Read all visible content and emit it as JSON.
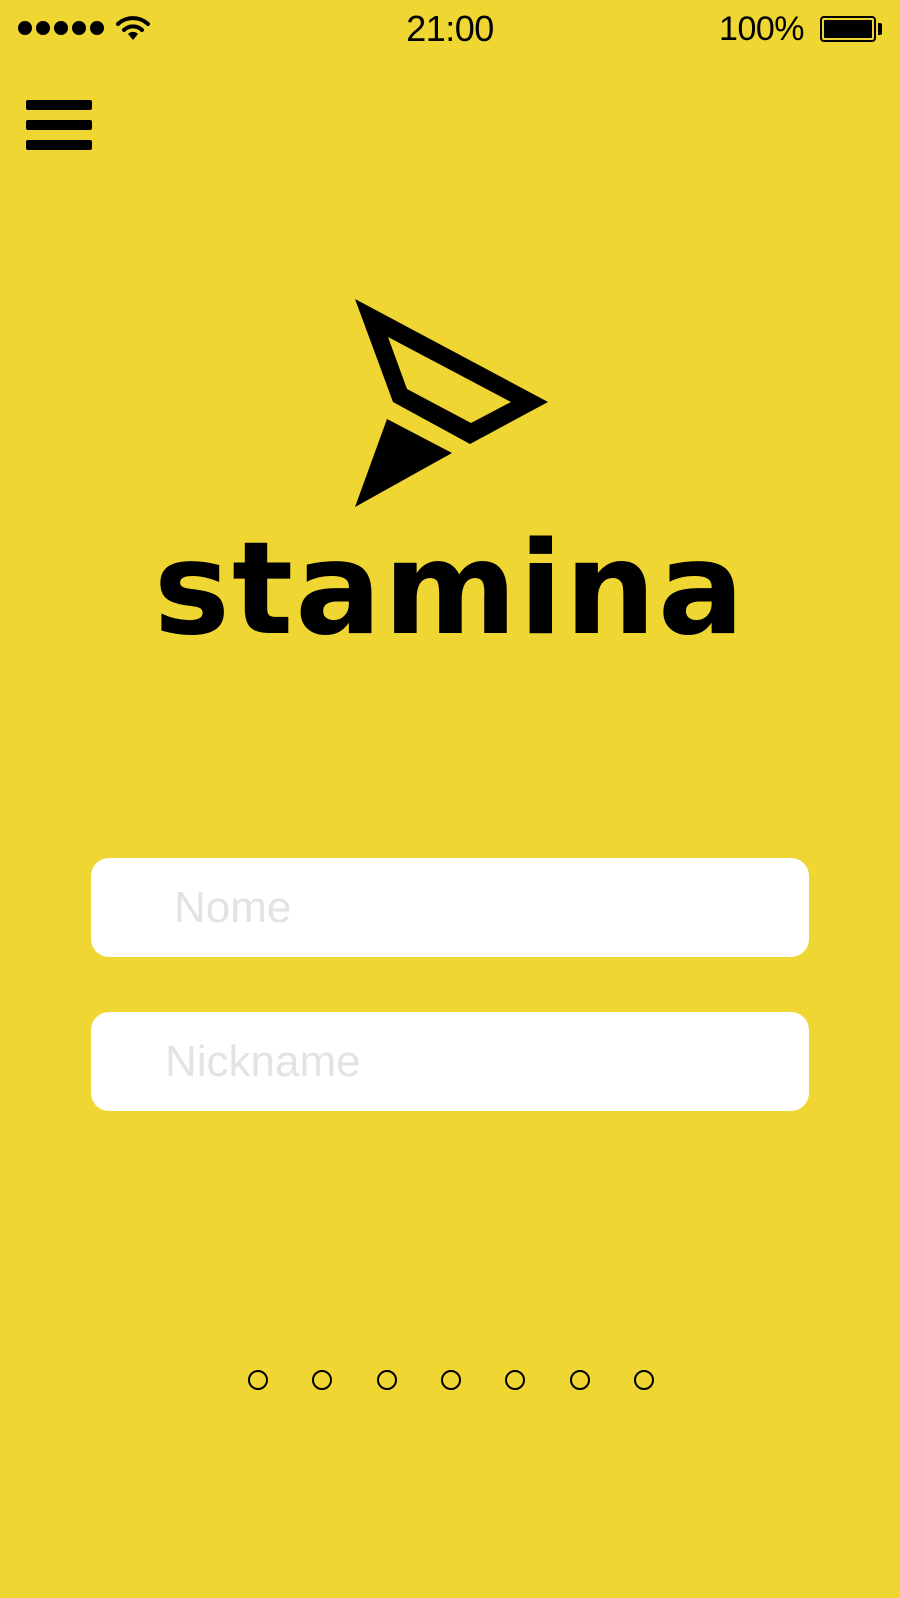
{
  "status_bar": {
    "time": "21:00",
    "battery_percent_label": "100%",
    "battery_level": 1.0,
    "signal_bars": 5,
    "wifi_icon": "wifi-icon"
  },
  "header": {
    "menu_icon": "hamburger-menu-icon"
  },
  "logo": {
    "wordmark": "stamina",
    "mark_icon": "paper-plane-arrow-logo"
  },
  "form": {
    "name_field": {
      "placeholder": "Nome",
      "value": ""
    },
    "nickname_field": {
      "placeholder": "Nickname",
      "value": ""
    }
  },
  "pager": {
    "page_count": 7,
    "current_page": null
  },
  "colors": {
    "background": "#EFD632",
    "foreground": "#000000",
    "field_background": "#FFFFFF",
    "placeholder": "#E3E3E3"
  }
}
